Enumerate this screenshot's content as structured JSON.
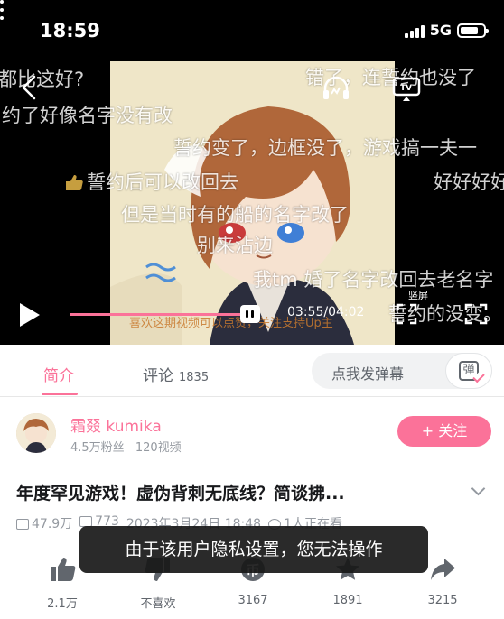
{
  "status_bar": {
    "time": "18:59",
    "network": "5G",
    "battery_level": 0.8
  },
  "player": {
    "danmaku": [
      "都比这好?",
      "错了，连誓约也没了",
      "约了好像名字没有改",
      "誓约变了，边框没了，游戏搞一夫一",
      "誓约后可以改回去",
      "好好好好",
      "但是当时有的船的名字改了",
      "别来沾边",
      "我tm 婚了名字改回去老名字",
      "誓约的没变。"
    ],
    "subtitle": "喜欢这期视频可以点赞，关注支持Up主",
    "current_time": "03:55",
    "duration": "04:02",
    "time_separator": "/",
    "progress": 0.97,
    "vertical_label": "竖屏"
  },
  "tabs": {
    "intro": "简介",
    "comments": "评论",
    "comments_count": "1835"
  },
  "danmaku_input": {
    "placeholder": "点我发弹幕",
    "button_glyph": "弹"
  },
  "uploader": {
    "name": "霜叕 kumika",
    "fans": "4.5万粉丝",
    "videos": "120视频",
    "follow_label": "+ 关注"
  },
  "video": {
    "title": "年度罕见游戏！虚伪背刺无底线？简谈拂...",
    "views": "47.9万",
    "danmaku_count": "773",
    "date": "2023年3月24日 18:48",
    "watching": "1人正在看"
  },
  "actions": [
    {
      "icon": "thumbs-up-icon",
      "label": "2.1万"
    },
    {
      "icon": "thumbs-down-icon",
      "label": "不喜欢"
    },
    {
      "icon": "coin-icon",
      "label": "3167"
    },
    {
      "icon": "star-icon",
      "label": "1891"
    },
    {
      "icon": "share-icon",
      "label": "3215"
    }
  ],
  "toast": "由于该用户隐私设置，您无法操作",
  "colors": {
    "accent": "#fb7299",
    "text": "#18191c",
    "muted": "#9499a0"
  }
}
